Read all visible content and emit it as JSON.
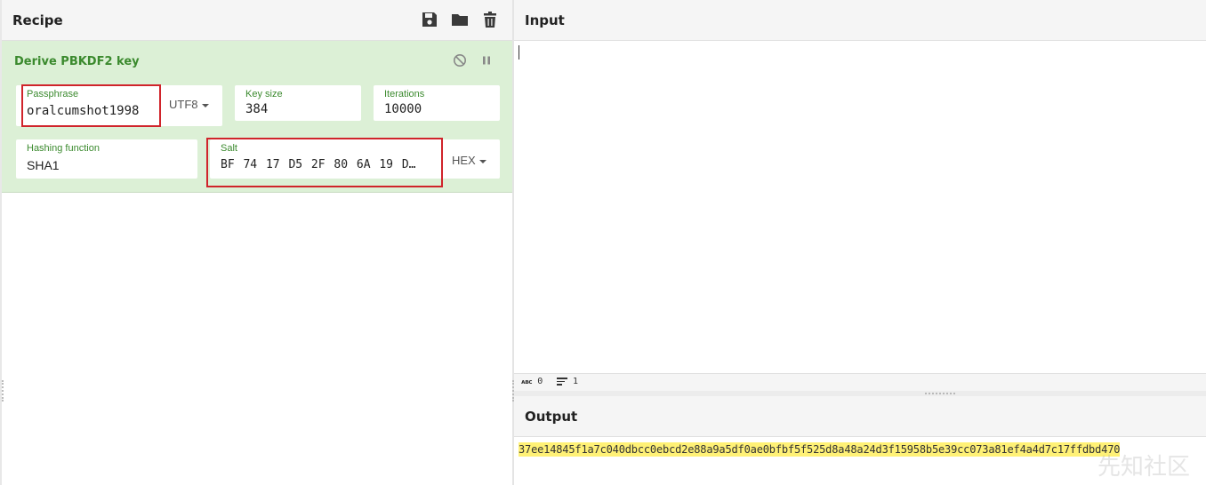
{
  "recipe": {
    "title": "Recipe",
    "icons": [
      "save-icon",
      "folder-icon",
      "trash-icon"
    ],
    "operation": {
      "title": "Derive PBKDF2 key",
      "controls": [
        "disable-icon",
        "pause-icon"
      ],
      "passphrase": {
        "label": "Passphrase",
        "value": "oralcumshot1998",
        "encoding": "UTF8"
      },
      "key_size": {
        "label": "Key size",
        "value": "384"
      },
      "iterations": {
        "label": "Iterations",
        "value": "10000"
      },
      "hashing_function": {
        "label": "Hashing function",
        "value": "SHA1"
      },
      "salt": {
        "label": "Salt",
        "value": "BF 74 17 D5 2F 80 6A 19 D…",
        "encoding": "HEX"
      }
    }
  },
  "input": {
    "title": "Input",
    "value": "",
    "status": {
      "chars": "0",
      "lines": "1"
    }
  },
  "output": {
    "title": "Output",
    "value": "37ee14845f1a7c040dbcc0ebcd2e88a9a5df0ae0bfbf5f525d8a48a24d3f15958b5e39cc073a81ef4a4d7c17ffdbd470"
  },
  "watermark": "先知社区",
  "colors": {
    "op_background": "#dcf0d6",
    "op_label": "#3b8a2e",
    "highlight_border": "#d0242b",
    "output_highlight": "#fff176"
  }
}
